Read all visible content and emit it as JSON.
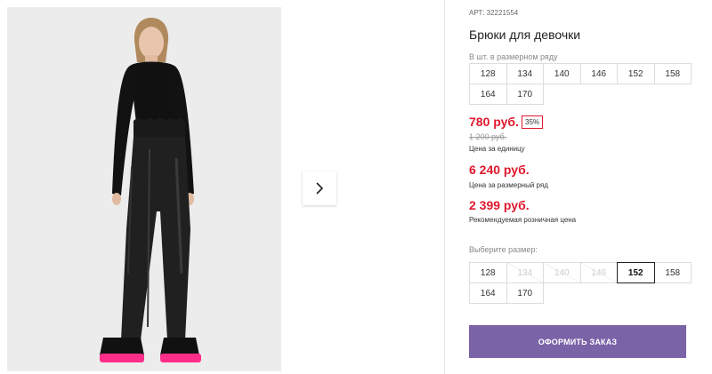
{
  "product": {
    "sku": "АРТ: 32221554",
    "title": "Брюки для девочки"
  },
  "size_row": {
    "hint": "В шт. в размерном ряду",
    "sizes": [
      "128",
      "134",
      "140",
      "146",
      "152",
      "158",
      "164",
      "170"
    ]
  },
  "pricing": {
    "unit_price": "780 руб.",
    "discount_badge": "35%",
    "old_price": "1 200 руб.",
    "unit_label": "Цена за единицу",
    "row_price": "6 240 руб.",
    "row_label": "Цена за размерный ряд",
    "retail_price": "2 399 руб.",
    "retail_label": "Рекомендуемая розничная цена"
  },
  "size_select": {
    "hint": "Выберите размер:",
    "sizes": [
      "128",
      "134",
      "140",
      "146",
      "152",
      "158",
      "164",
      "170"
    ],
    "disabled": [
      "134",
      "140",
      "146"
    ],
    "selected": "152"
  },
  "actions": {
    "order_label": "ОФОРМИТЬ ЗАКАЗ"
  },
  "colors": {
    "price_red": "#e0182d",
    "button_purple": "#7b63a8",
    "sole_pink": "#ff2d8a"
  }
}
